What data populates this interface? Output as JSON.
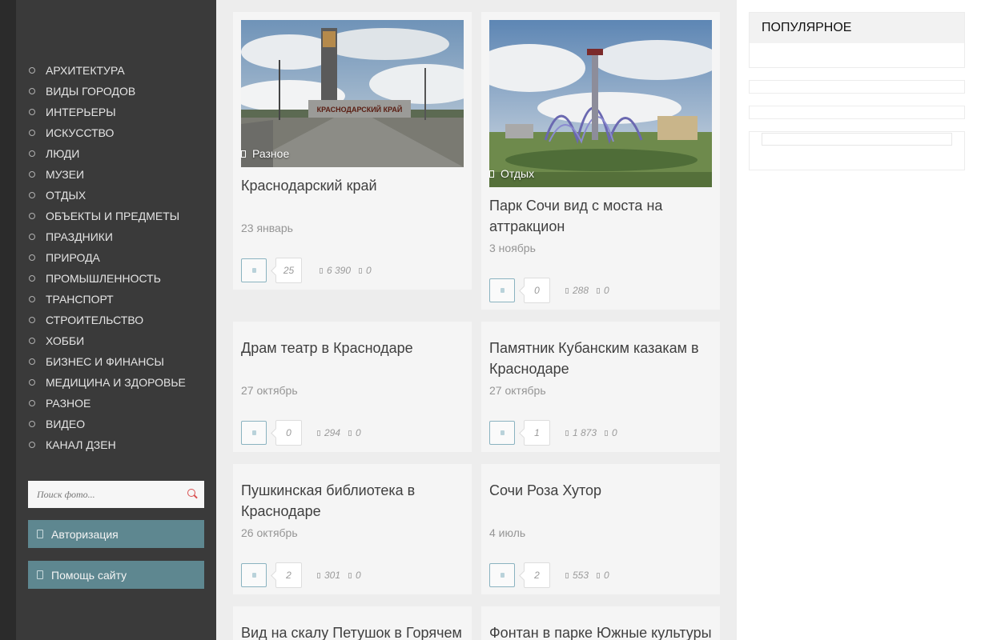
{
  "sidebar": {
    "categories": [
      "АРХИТЕКТУРА",
      "ВИДЫ ГОРОДОВ",
      "ИНТЕРЬЕРЫ",
      "ИСКУССТВО",
      "ЛЮДИ",
      "МУЗЕИ",
      "ОТДЫХ",
      "ОБЪЕКТЫ И ПРЕДМЕТЫ",
      "ПРАЗДНИКИ",
      "ПРИРОДА",
      "ПРОМЫШЛЕННОСТЬ",
      "ТРАНСПОРТ",
      "СТРОИТЕЛЬСТВО",
      "ХОББИ",
      "БИЗНЕС И ФИНАНСЫ",
      "МЕДИЦИНА И ЗДОРОВЬЕ",
      "РАЗНОЕ",
      "ВИДЕО",
      "КАНАЛ ДЗЕН"
    ],
    "search_placeholder": "Поиск фото...",
    "auth_label": "Авторизация",
    "help_label": "Помощь сайту"
  },
  "posts": [
    {
      "title": "Краснодарский край",
      "date": "23 январь",
      "category": "Разное",
      "likes": "25",
      "views": "6 390",
      "comments": "0"
    },
    {
      "title": "Парк Сочи вид с моста на аттракцион",
      "date": "3 ноябрь",
      "category": "Отдых",
      "likes": "0",
      "views": "288",
      "comments": "0"
    },
    {
      "title": "Драм театр в Краснодаре",
      "date": "27 октябрь",
      "likes": "0",
      "views": "294",
      "comments": "0"
    },
    {
      "title": "Памятник Кубанским казакам в Краснодаре",
      "date": "27 октябрь",
      "likes": "1",
      "views": "1 873",
      "comments": "0"
    },
    {
      "title": "Пушкинская библиотека в Краснодаре",
      "date": "26 октябрь",
      "likes": "2",
      "views": "301",
      "comments": "0"
    },
    {
      "title": "Сочи Роза Хутор",
      "date": "4 июль",
      "likes": "2",
      "views": "553",
      "comments": "0"
    },
    {
      "title": "Вид на скалу Петушок в Горячем"
    },
    {
      "title": "Фонтан в парке Южные культуры"
    }
  ],
  "image_texts": {
    "krasnodar_sign": "КРАСНОДАРСКИЙ КРАЙ"
  },
  "popular": {
    "title": "ПОПУЛЯРНОЕ"
  }
}
